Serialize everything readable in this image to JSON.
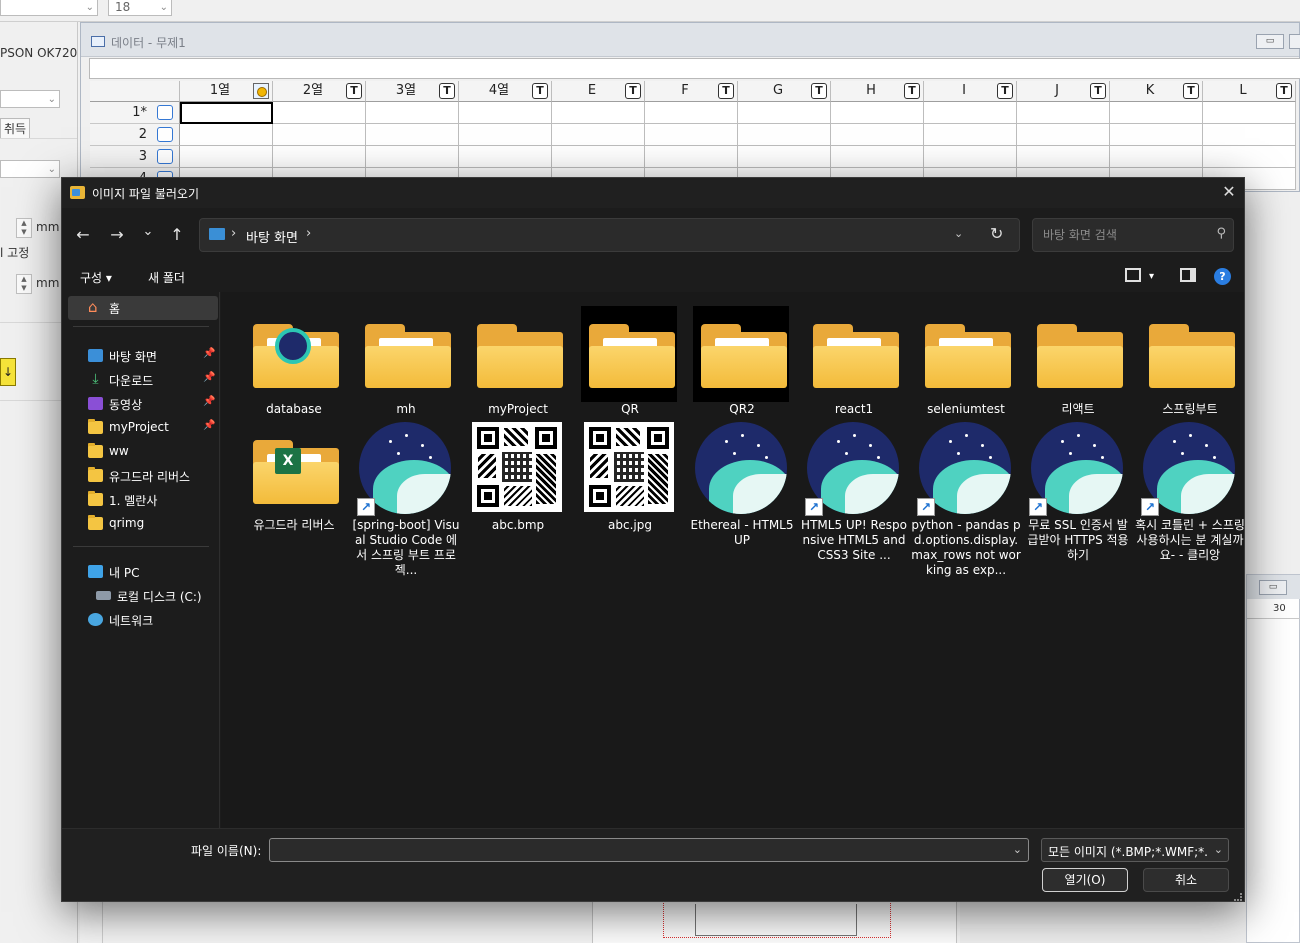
{
  "bg": {
    "font_size": "18",
    "left_labels": {
      "printer": "PSON OK720",
      "acquire": "취득",
      "unit1": "mm",
      "fix": "l 고정",
      "unit2": "mm"
    },
    "data_window": {
      "title": "데이터  - 무제1",
      "minimize": "▭",
      "columns": [
        "1열",
        "2열",
        "3열",
        "4열",
        "E",
        "F",
        "G",
        "H",
        "I",
        "J",
        "K",
        "L"
      ],
      "column_marker": "T",
      "rows": [
        "1*",
        "2",
        "3",
        "4"
      ]
    },
    "right_window": {
      "ruler_mark": "30"
    }
  },
  "dialog": {
    "title": "이미지 파일 불러오기",
    "close": "✕",
    "nav": {
      "back": "←",
      "forward": "→",
      "recent": "⌄",
      "up": "↑"
    },
    "address": {
      "sep": "›",
      "crumb": "바탕 화면",
      "dropdown": "⌄",
      "refresh": "↻"
    },
    "search": {
      "placeholder": "바탕 화면 검색",
      "icon": "search-icon"
    },
    "commands": {
      "organize": "구성 ▾",
      "new_folder": "새 폴더",
      "view_menu": "▾",
      "help": "?"
    },
    "nav_pane": [
      {
        "label": "홈",
        "icon": "home-icon"
      },
      {
        "label": "바탕 화면",
        "icon": "desktop-icon",
        "pinned": true
      },
      {
        "label": "다운로드",
        "icon": "download-icon",
        "pinned": true
      },
      {
        "label": "동영상",
        "icon": "video-icon",
        "pinned": true
      },
      {
        "label": "myProject",
        "icon": "folder-icon",
        "pinned": true
      },
      {
        "label": "ww",
        "icon": "folder-icon"
      },
      {
        "label": "유그드라 리버스",
        "icon": "folder-icon"
      },
      {
        "label": "1. 멜란사",
        "icon": "folder-icon"
      },
      {
        "label": "qrimg",
        "icon": "folder-icon"
      },
      {
        "label": "내 PC",
        "icon": "pc-icon"
      },
      {
        "label": "로컬 디스크 (C:)",
        "icon": "drive-icon"
      },
      {
        "label": "네트워크",
        "icon": "network-icon"
      }
    ],
    "pin_glyph": "📌",
    "files": [
      {
        "name": "database",
        "kind": "folder-globe"
      },
      {
        "name": "mh",
        "kind": "folder-doc"
      },
      {
        "name": "myProject",
        "kind": "folder"
      },
      {
        "name": "QR",
        "kind": "folder-paper"
      },
      {
        "name": "QR2",
        "kind": "folder-paper"
      },
      {
        "name": "react1",
        "kind": "folder-doc"
      },
      {
        "name": "seleniumtest",
        "kind": "folder-doc"
      },
      {
        "name": "리액트",
        "kind": "folder"
      },
      {
        "name": "스프링부트",
        "kind": "folder"
      },
      {
        "name": "유그드라 리버스",
        "kind": "folder-excel"
      },
      {
        "name": "[spring-boot] Visual Studio Code 에서 스프링 부트 프로젝...",
        "kind": "shortcut"
      },
      {
        "name": "abc.bmp",
        "kind": "qr"
      },
      {
        "name": "abc.jpg",
        "kind": "qr"
      },
      {
        "name": "Ethereal - HTML5 UP",
        "kind": "whale"
      },
      {
        "name": "HTML5 UP! Responsive HTML5 and CSS3 Site ...",
        "kind": "shortcut"
      },
      {
        "name": "python - pandas pd.options.display.max_rows not working as exp...",
        "kind": "shortcut"
      },
      {
        "name": "무료 SSL 인증서 발급받아 HTTPS 적용하기",
        "kind": "shortcut"
      },
      {
        "name": "혹시 코틀린 + 스프링 사용하시는 분 계실까요- - 클리앙",
        "kind": "shortcut"
      }
    ],
    "footer": {
      "filename_label": "파일 이름(N):",
      "filename_value": "",
      "filter": "모든 이미지 (*.BMP;*.WMF;*.EMF",
      "open": "열기(O)",
      "cancel": "취소"
    }
  }
}
